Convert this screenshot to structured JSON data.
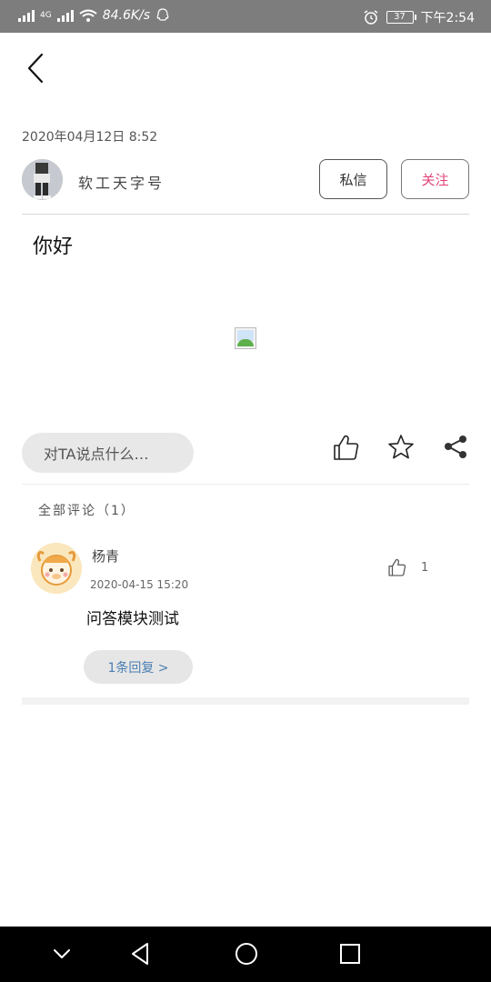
{
  "status_bar": {
    "network_label": "4G",
    "net_speed": "84.6K/s",
    "battery_level": "37",
    "time": "下午2:54"
  },
  "post": {
    "date": "2020年04月12日 8:52",
    "author_name": "软工天字号",
    "message_button": "私信",
    "follow_button": "关注",
    "body": "你好",
    "comment_placeholder": "对TA说点什么…"
  },
  "comments": {
    "heading": "全部评论（1）",
    "items": [
      {
        "author": "杨青",
        "time": "2020-04-15 15:20",
        "like_count": "1",
        "text": "问答模块测试",
        "reply_label": "1条回复 >"
      }
    ]
  },
  "colors": {
    "status_bar_bg": "#7d7d7d",
    "follow_accent": "#e0457b",
    "reply_link": "#4a7fb3",
    "nav_bar_bg": "#000000"
  },
  "icons": [
    "back-arrow-icon",
    "thumbs-up-icon",
    "star-icon",
    "share-icon",
    "nav-down-icon",
    "nav-back-icon",
    "nav-home-icon",
    "nav-recent-icon"
  ]
}
